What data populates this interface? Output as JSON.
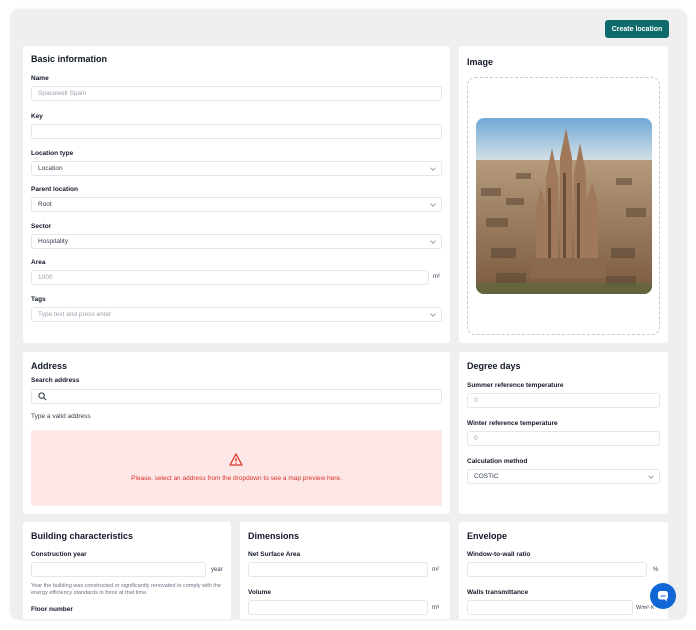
{
  "header": {
    "create_button": "Create location"
  },
  "basic": {
    "title": "Basic information",
    "name_label": "Name",
    "name_value": "Spacewell Spain",
    "key_label": "Key",
    "key_value": "",
    "location_type_label": "Location type",
    "location_type_value": "Location",
    "parent_label": "Parent location",
    "parent_value": "Root",
    "sector_label": "Sector",
    "sector_value": "Hospitality",
    "area_label": "Area",
    "area_placeholder": "1000",
    "area_unit": "m²",
    "tags_label": "Tags",
    "tags_placeholder": "Type text and press enter"
  },
  "image": {
    "title": "Image"
  },
  "address": {
    "title": "Address",
    "search_label": "Search address",
    "search_value": "",
    "hint": "Type a valid address",
    "warning": "Please, select an address from the dropdown to see a map preview here."
  },
  "degree_days": {
    "title": "Degree days",
    "summer_label": "Summer reference temperature",
    "summer_value": "0",
    "winter_label": "Winter reference temperature",
    "winter_value": "0",
    "method_label": "Calculation method",
    "method_value": "COSTIC"
  },
  "building": {
    "title": "Building characteristics",
    "construction_label": "Construction year",
    "construction_unit": "year",
    "construction_hint": "Year the building was constructed or significantly renovated to comply with the energy efficiency standards in force at that time.",
    "floor_label": "Floor number"
  },
  "dimensions": {
    "title": "Dimensions",
    "net_label": "Net Surface Area",
    "net_unit": "m²",
    "volume_label": "Volume",
    "volume_unit": "m³"
  },
  "envelope": {
    "title": "Envelope",
    "wwr_label": "Window-to-wall ratio",
    "wwr_unit": "%",
    "walls_label": "Walls transmittance",
    "walls_unit": "W/m²·K"
  },
  "colors": {
    "accent": "#0f6b6b",
    "warning_bg": "#fde7e7",
    "warning_text": "#d9342b",
    "chat": "#1166d6"
  }
}
